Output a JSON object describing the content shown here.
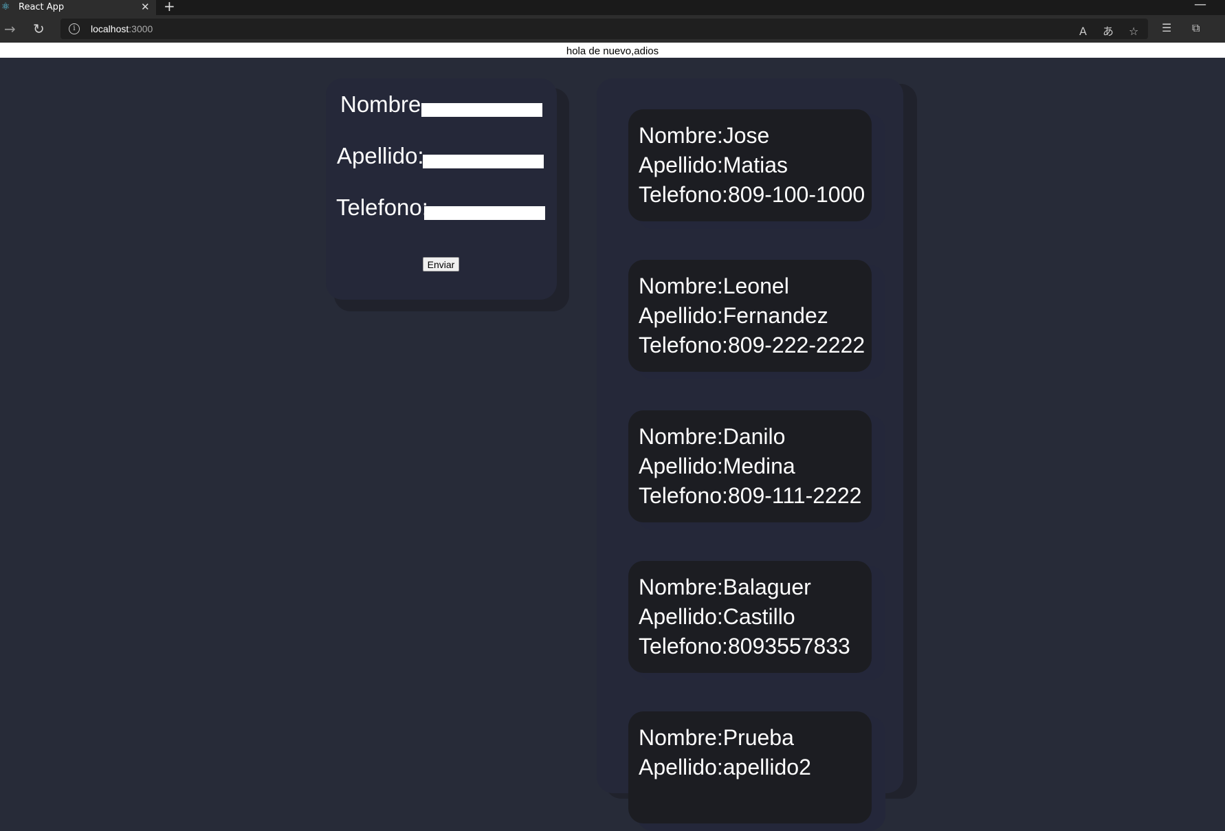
{
  "browser": {
    "tab_title": "React App",
    "url_host": "localhost",
    "url_port": ":3000"
  },
  "header": {
    "text": "hola de nuevo,adios"
  },
  "form": {
    "nombre_label": "Nombre",
    "apellido_label": "Apellido:",
    "telefono_label": "Telefono:",
    "nombre_value": "",
    "apellido_value": "",
    "telefono_value": "",
    "submit_label": "Enviar"
  },
  "contacts": [
    {
      "nombre": "Nombre:Jose",
      "apellido": "Apellido:Matias",
      "telefono": "Telefono:809-100-1000"
    },
    {
      "nombre": "Nombre:Leonel",
      "apellido": "Apellido:Fernandez",
      "telefono": "Telefono:809-222-2222"
    },
    {
      "nombre": "Nombre:Danilo",
      "apellido": "Apellido:Medina",
      "telefono": "Telefono:809-111-2222"
    },
    {
      "nombre": "Nombre:Balaguer",
      "apellido": "Apellido:Castillo",
      "telefono": "Telefono:8093557833"
    },
    {
      "nombre": "Nombre:Prueba",
      "apellido": "Apellido:apellido2",
      "telefono": ""
    }
  ],
  "colors": {
    "page_bg": "#272b38",
    "panel_bg": "#252839",
    "card_bg": "#1c1d22",
    "text": "#ffffff"
  }
}
